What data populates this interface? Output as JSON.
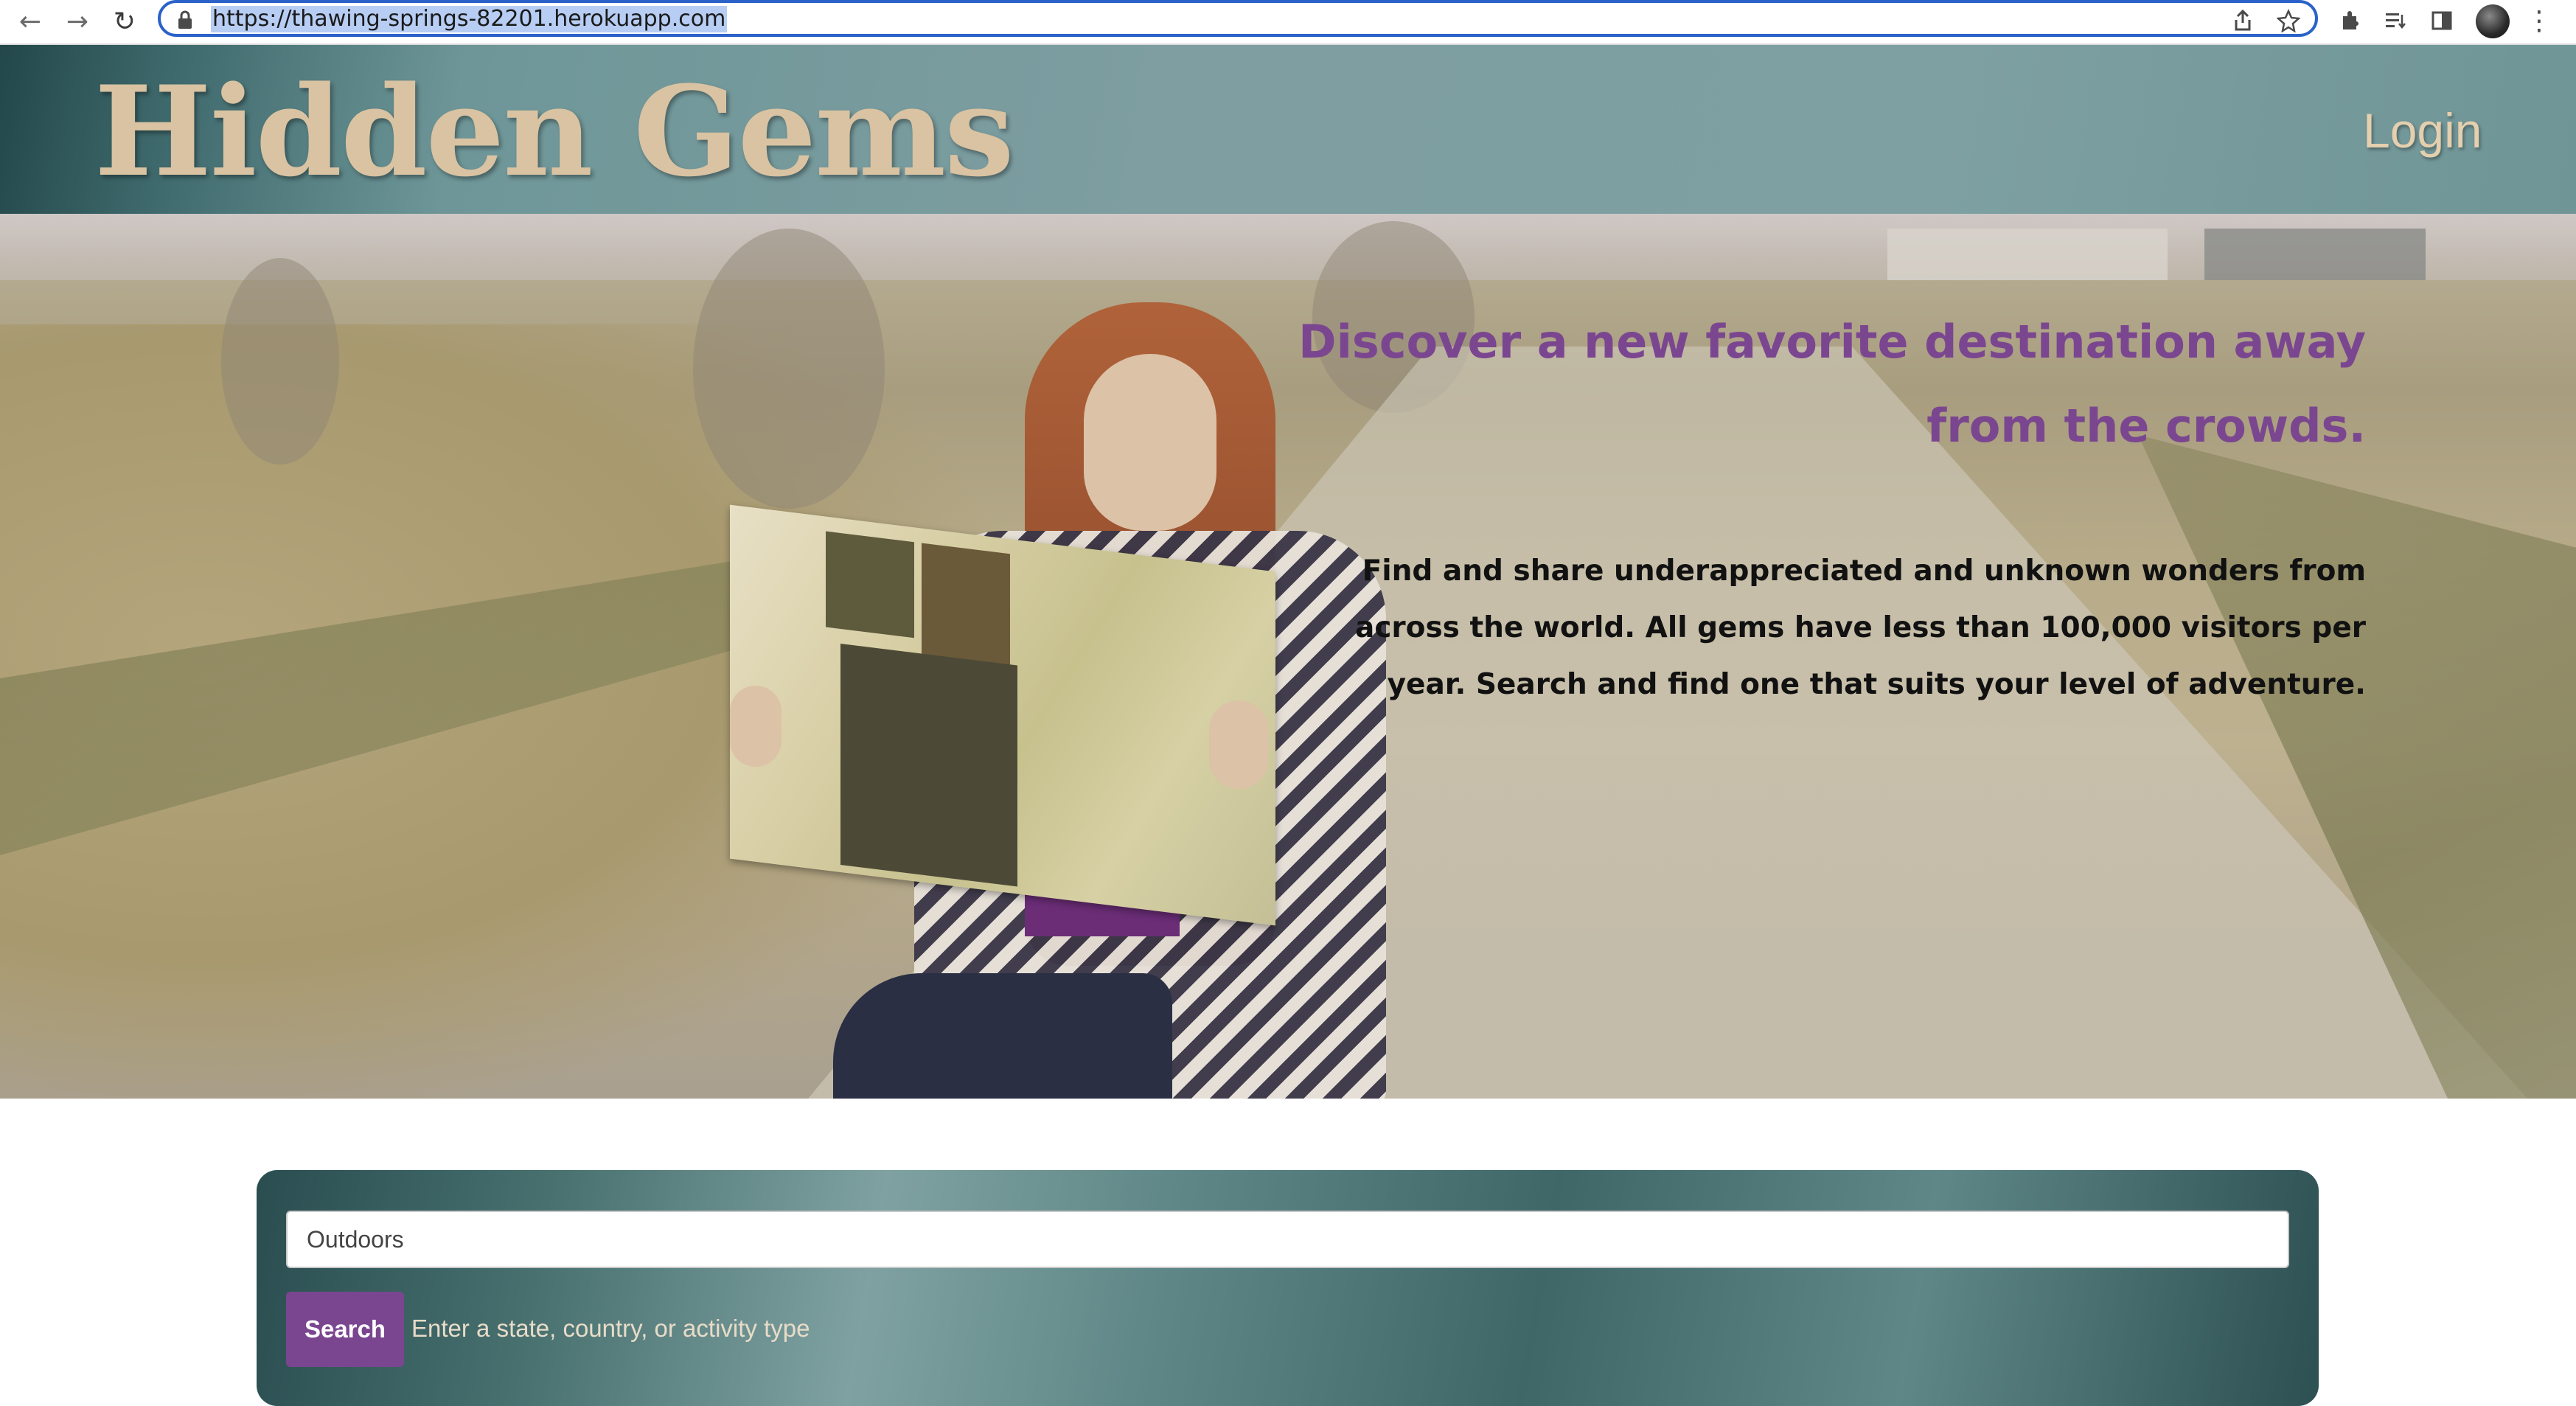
{
  "browser": {
    "url": "https://thawing-springs-82201.herokuapp.com",
    "back_icon": "←",
    "forward_icon": "→",
    "reload_icon": "↻"
  },
  "header": {
    "brand": "Hidden Gems",
    "login_label": "Login"
  },
  "hero": {
    "headline": "Discover a new favorite destination away from the crowds.",
    "subtext": "Find and share underappreciated and unknown wonders from across the world. All gems have less than 100,000 visitors per year. Search and find one that suits your level of adventure."
  },
  "search": {
    "value": "Outdoors",
    "button_label": "Search",
    "hint": "Enter a state, country, or activity type"
  },
  "colors": {
    "accent_purple": "#7b4690",
    "header_teal": "#7e9ea1",
    "brand_tan": "#d9c3a2"
  }
}
